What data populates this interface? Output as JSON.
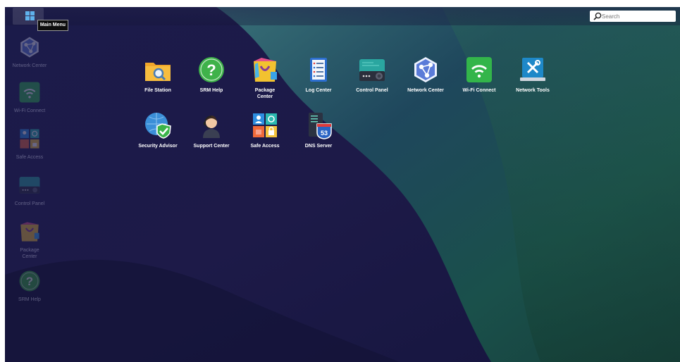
{
  "taskbar": {
    "tooltip": "Main Menu",
    "search_placeholder": "Search"
  },
  "desktop_icons": [
    {
      "label": "Network Center",
      "icon": "network-center-icon"
    },
    {
      "label": "Wi-Fi Connect",
      "icon": "wifi-connect-icon"
    },
    {
      "label": "Safe Access",
      "icon": "safe-access-icon"
    },
    {
      "label": "Control Panel",
      "icon": "control-panel-icon"
    },
    {
      "label": "Package Center",
      "icon": "package-center-icon"
    },
    {
      "label": "SRM Help",
      "icon": "srm-help-icon"
    }
  ],
  "main_menu": {
    "apps": [
      {
        "label": "File Station",
        "icon": "file-station-icon"
      },
      {
        "label": "SRM Help",
        "icon": "srm-help-icon"
      },
      {
        "label": "Package Center",
        "icon": "package-center-icon"
      },
      {
        "label": "Log Center",
        "icon": "log-center-icon"
      },
      {
        "label": "Control Panel",
        "icon": "control-panel-icon"
      },
      {
        "label": "Network Center",
        "icon": "network-center-icon"
      },
      {
        "label": "Wi-Fi Connect",
        "icon": "wifi-connect-icon"
      },
      {
        "label": "Network Tools",
        "icon": "network-tools-icon"
      },
      {
        "label": "Security Advisor",
        "icon": "security-advisor-icon"
      },
      {
        "label": "Support Center",
        "icon": "support-center-icon"
      },
      {
        "label": "Safe Access",
        "icon": "safe-access-icon"
      },
      {
        "label": "DNS Server",
        "icon": "dns-server-icon"
      }
    ],
    "dns_badge": "53"
  }
}
